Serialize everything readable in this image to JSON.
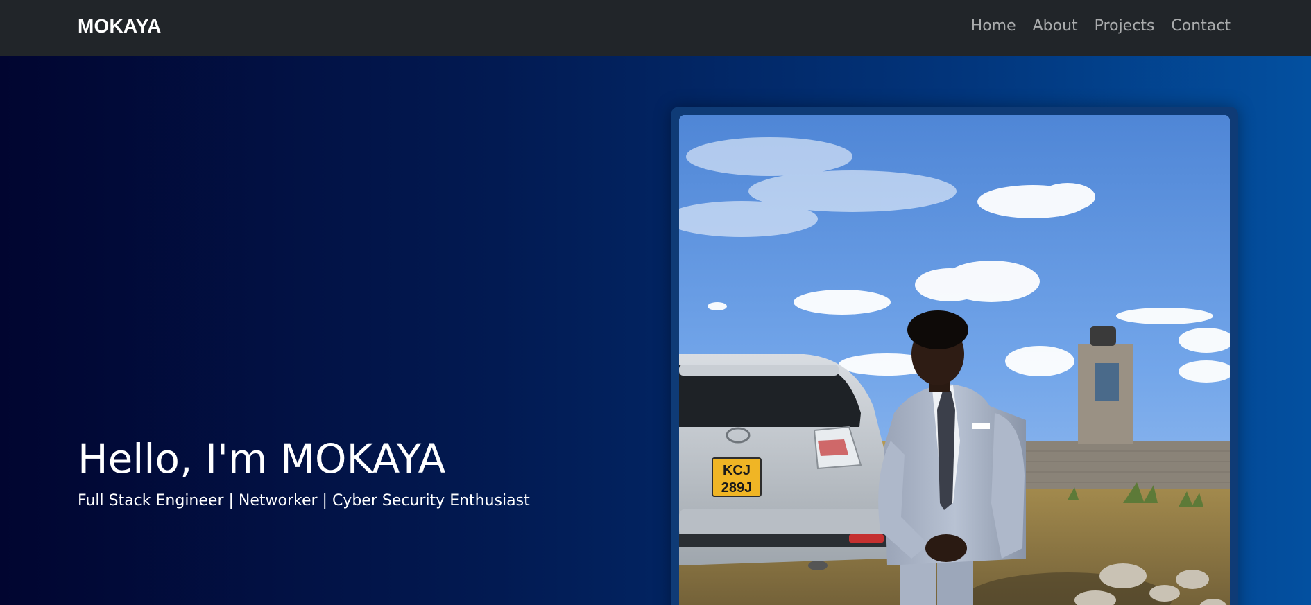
{
  "navbar": {
    "brand": "MOKAYA",
    "links": [
      {
        "label": "Home"
      },
      {
        "label": "About"
      },
      {
        "label": "Projects"
      },
      {
        "label": "Contact"
      }
    ]
  },
  "hero": {
    "heading": "Hello, I'm MOKAYA",
    "subtitle": "Full Stack Engineer | Networker | Cyber Security Enthusiast",
    "photo": {
      "plate_line1": "KCJ",
      "plate_line2": "289J"
    }
  },
  "colors": {
    "navbar_bg": "#212529",
    "hero_gradient_start": "#010530",
    "hero_gradient_end": "#0350a0",
    "frame": "#0f3b76"
  }
}
